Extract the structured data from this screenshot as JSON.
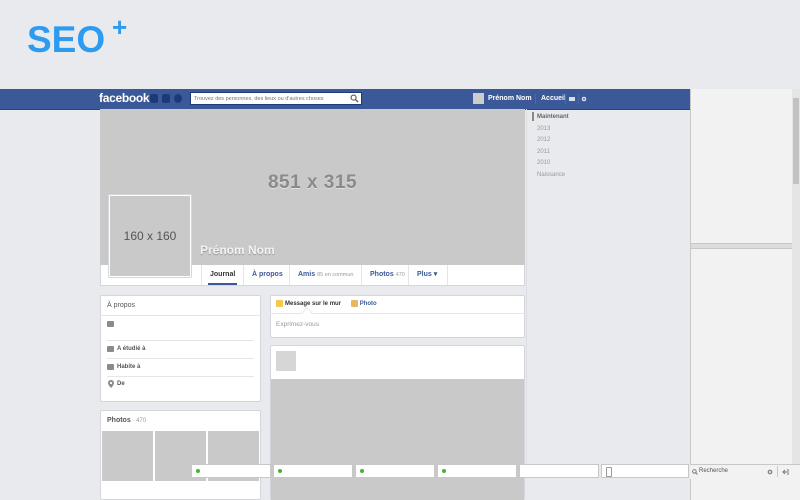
{
  "logo": {
    "text": "SEO",
    "plus": "+",
    "color": "#2d9bf0"
  },
  "topbar": {
    "brand": "facebook",
    "bg_color": "#3b5998",
    "search_placeholder": "Trouvez des personnes, des lieux ou d'autres choses",
    "user_name": "Prénom Nom",
    "home_label": "Accueil",
    "icons": [
      "friends-icon",
      "messages-icon",
      "notifications-icon",
      "search-icon",
      "privacy-icon",
      "settings-icon"
    ]
  },
  "cover": {
    "label": "851 x 315"
  },
  "profile_picture": {
    "label": "160 x 160"
  },
  "profile_name": "Prénom Nom",
  "tabs": [
    {
      "label": "Journal",
      "sub": ""
    },
    {
      "label": "À propos",
      "sub": ""
    },
    {
      "label": "Amis",
      "sub": "85 en commun"
    },
    {
      "label": "Photos",
      "sub": "470"
    },
    {
      "label": "Plus ▾",
      "sub": ""
    }
  ],
  "timeline": [
    "Maintenant",
    "2013",
    "2012",
    "2011",
    "2010",
    "Naissance"
  ],
  "about": {
    "title": "À propos",
    "rows": [
      {
        "label": "",
        "icon": "briefcase-icon"
      },
      {
        "label": "A étudié à",
        "icon": "school-icon"
      },
      {
        "label": "Habite à",
        "icon": "home-icon"
      },
      {
        "label": "De",
        "icon": "location-pin-icon"
      }
    ]
  },
  "photos": {
    "title": "Photos",
    "count": " · 470"
  },
  "composer": {
    "status_tab": "Message sur le mur",
    "photo_tab": "Photo",
    "placeholder": "Exprimez-vous"
  },
  "right_sidebar": {
    "search_placeholder": "Recherche"
  }
}
